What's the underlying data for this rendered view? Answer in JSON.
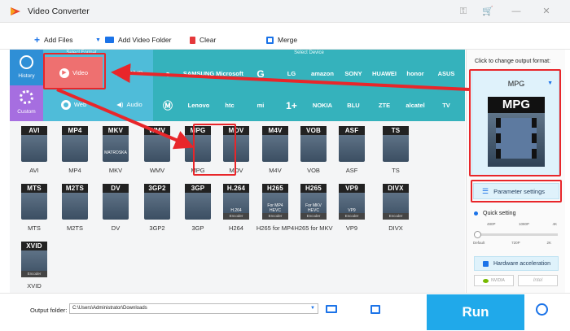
{
  "colors": {
    "accent": "#1ba8f0",
    "format_bg": "#4fbcd9",
    "device_bg": "#35b2bc",
    "history_bg": "#2f8fd6",
    "custom_bg": "#a66ee0",
    "highlight": "#e8262a",
    "run_bg": "#20a9ea"
  },
  "app": {
    "title": "Video Converter"
  },
  "toolbar": {
    "add_files": "Add Files",
    "add_video_folder": "Add Video Folder",
    "clear": "Clear",
    "merge": "Merge"
  },
  "sections": {
    "format": "Select Format",
    "device": "Select Device"
  },
  "side": {
    "history": "History",
    "custom": "Custom"
  },
  "categories": {
    "video": "Video",
    "uhd": "4K/HD",
    "web": "Web",
    "audio": "Audio"
  },
  "brands_row1": [
    "apple-logo",
    "SAMSUNG",
    "Microsoft",
    "google-logo",
    "LG",
    "amazon",
    "SONY",
    "HUAWEI",
    "honor",
    "ASUS"
  ],
  "brands_row2": [
    "motorola-logo",
    "Lenovo",
    "htc",
    "mi",
    "oneplus-logo",
    "NOKIA",
    "BLU",
    "ZTE",
    "alcatel",
    "TV"
  ],
  "formats_row1": [
    {
      "tag": "AVI",
      "sub": "",
      "bar": "",
      "label": "AVI"
    },
    {
      "tag": "MP4",
      "sub": "",
      "bar": "",
      "label": "MP4"
    },
    {
      "tag": "MKV",
      "sub": "MATROSKA",
      "bar": "",
      "label": "MKV"
    },
    {
      "tag": "WMV",
      "sub": "",
      "bar": "",
      "label": "WMV"
    },
    {
      "tag": "MPG",
      "sub": "",
      "bar": "",
      "label": "MPG"
    },
    {
      "tag": "MOV",
      "sub": "",
      "bar": "",
      "label": "MOV"
    },
    {
      "tag": "M4V",
      "sub": "",
      "bar": "",
      "label": "M4V"
    },
    {
      "tag": "VOB",
      "sub": "",
      "bar": "",
      "label": "VOB"
    },
    {
      "tag": "ASF",
      "sub": "",
      "bar": "",
      "label": "ASF"
    },
    {
      "tag": "TS",
      "sub": "",
      "bar": "",
      "label": "TS"
    }
  ],
  "formats_row2": [
    {
      "tag": "MTS",
      "sub": "",
      "bar": "",
      "label": "MTS"
    },
    {
      "tag": "M2TS",
      "sub": "",
      "bar": "",
      "label": "M2TS"
    },
    {
      "tag": "DV",
      "sub": "",
      "bar": "",
      "label": "DV"
    },
    {
      "tag": "3GP2",
      "sub": "",
      "bar": "",
      "label": "3GP2"
    },
    {
      "tag": "3GP",
      "sub": "",
      "bar": "",
      "label": "3GP"
    },
    {
      "tag": "H.264",
      "sub": "H.264",
      "bar": "Encoder",
      "label": "H264"
    },
    {
      "tag": "H265",
      "sub": "For MP4 HEVC",
      "bar": "Encoder",
      "label": "H265 for MP4"
    },
    {
      "tag": "H265",
      "sub": "For MKV HEVC",
      "bar": "Encoder",
      "label": "H265 for MKV"
    },
    {
      "tag": "VP9",
      "sub": "VP9",
      "bar": "Encoder",
      "label": "VP9"
    },
    {
      "tag": "DIVX",
      "sub": "",
      "bar": "Encoder",
      "label": "DIVX"
    }
  ],
  "formats_row3": [
    {
      "tag": "XVID",
      "sub": "",
      "bar": "Encoder",
      "label": "XVID"
    }
  ],
  "right": {
    "click_to_change": "Click to change output format:",
    "selected_format": "MPG",
    "preview_tag": "MPG",
    "parameter_settings": "Parameter settings",
    "quick_setting": "Quick setting",
    "quick_top": [
      "480P",
      "1080P",
      "4K"
    ],
    "quick_bottom": [
      "Default",
      "720P",
      "2K"
    ],
    "quick_level": 0,
    "hw_accel": "Hardware acceleration",
    "nvidia": "NVIDIA",
    "intel": "Intel"
  },
  "bottom": {
    "output_label": "Output folder:",
    "output_path": "C:\\Users\\Administrator\\Downloads",
    "run": "Run"
  }
}
